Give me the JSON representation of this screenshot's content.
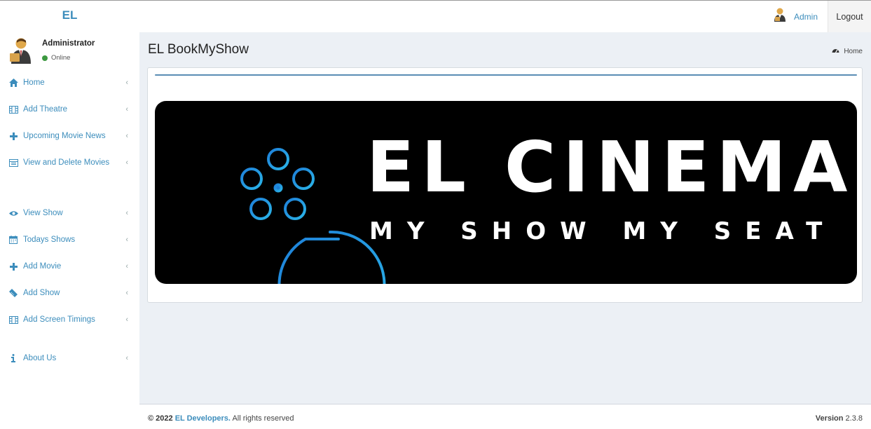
{
  "header": {
    "logo": "EL",
    "user_name": "Admin",
    "logout_label": "Logout"
  },
  "sidebar": {
    "user": {
      "name": "Administrator",
      "status": "Online"
    },
    "items": [
      {
        "label": "Home",
        "icon": "home-icon"
      },
      {
        "label": "Add Theatre",
        "icon": "film-icon"
      },
      {
        "label": "Upcoming Movie News",
        "icon": "plus-icon"
      },
      {
        "label": "View and Delete Movies",
        "icon": "list-icon"
      },
      {
        "label": "View Show",
        "icon": "eye-icon"
      },
      {
        "label": "Todays Shows",
        "icon": "calendar-icon"
      },
      {
        "label": "Add Movie",
        "icon": "plus-icon"
      },
      {
        "label": "Add Show",
        "icon": "ticket-icon"
      },
      {
        "label": "Add Screen Timings",
        "icon": "film-icon"
      },
      {
        "label": "About Us",
        "icon": "info-icon"
      }
    ]
  },
  "main": {
    "title": "EL BookMyShow",
    "breadcrumb": "Home",
    "banner": {
      "title": "EL CINEMA",
      "tagline": "MY SHOW MY SEAT"
    }
  },
  "footer": {
    "copyright": "© 2022",
    "developer": "EL Developers.",
    "rights": "All rights reserved",
    "version_label": "Version",
    "version": "2.3.8"
  },
  "colors": {
    "accent": "#3c8dbc",
    "online": "#3d9940",
    "banner_bg": "#000000",
    "reel": "#1f8fd6"
  }
}
